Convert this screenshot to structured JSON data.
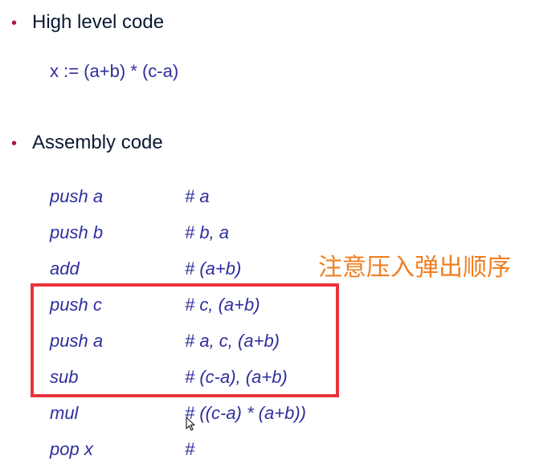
{
  "sections": {
    "high_level": {
      "bullet": "•",
      "heading": "High level code",
      "code": "x := (a+b) * (c-a)"
    },
    "assembly": {
      "bullet": "•",
      "heading": "Assembly code",
      "lines": [
        {
          "instr": "push a",
          "stack": "# a"
        },
        {
          "instr": "push b",
          "stack": "# b, a"
        },
        {
          "instr": "add",
          "stack": "# (a+b)"
        },
        {
          "instr": "push c",
          "stack": "# c, (a+b)"
        },
        {
          "instr": "push a",
          "stack": "# a, c, (a+b)"
        },
        {
          "instr": "sub",
          "stack": "# (c-a), (a+b)"
        },
        {
          "instr": "mul",
          "stack": "# ((c-a) * (a+b))"
        },
        {
          "instr": "pop x",
          "stack": "#"
        }
      ]
    }
  },
  "annotation": {
    "text": "注意压入弹出顺序"
  },
  "colors": {
    "bullet": "#b0144a",
    "heading": "#0b1a33",
    "code": "#2e2e9e",
    "highlight_border": "#e8343a",
    "annotation": "#f07f22"
  },
  "icons": {
    "cursor": "mouse-pointer-icon"
  }
}
